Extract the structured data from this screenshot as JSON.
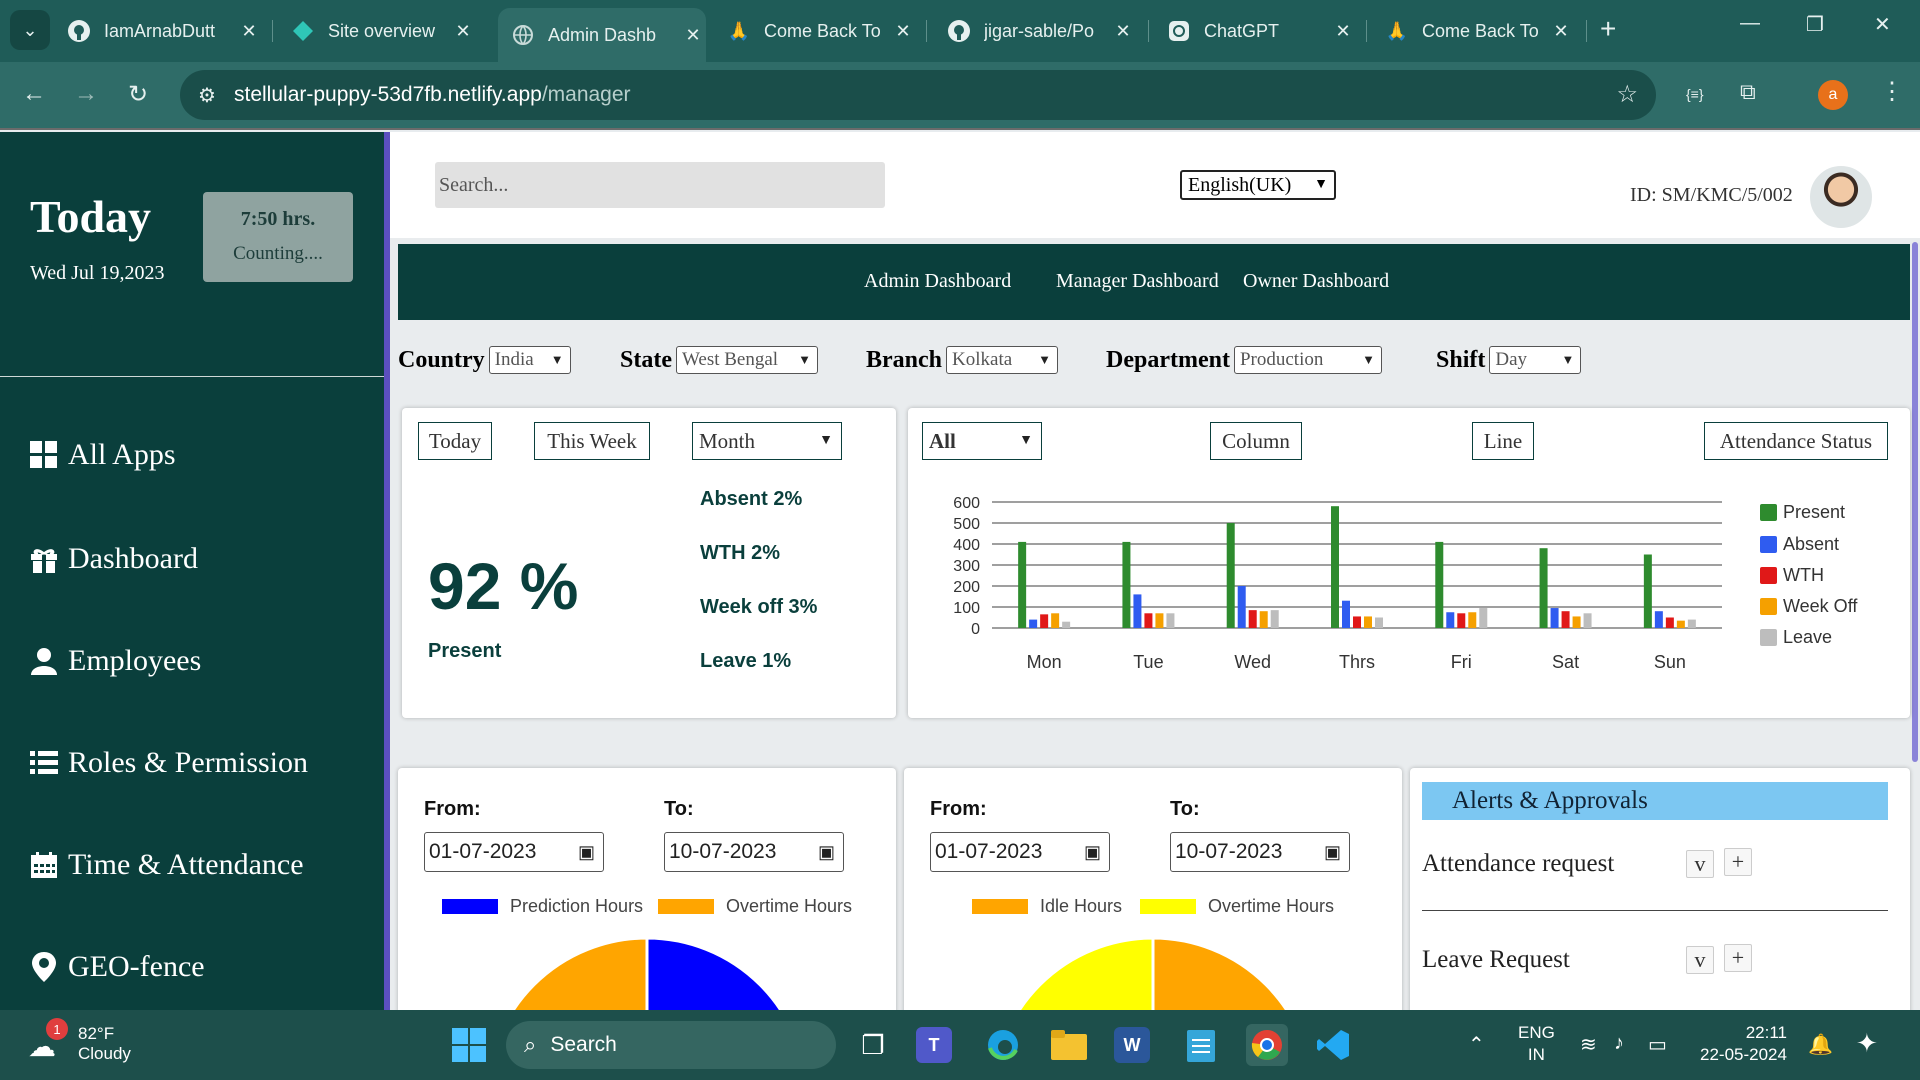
{
  "browser": {
    "tabs": [
      {
        "title": "IamArnabDutt",
        "icon": "github-icon"
      },
      {
        "title": "Site overview",
        "icon": "netlify-icon"
      },
      {
        "title": "Admin Dashb",
        "icon": "globe-icon"
      },
      {
        "title": "Come Back To",
        "icon": "folded-hands-icon"
      },
      {
        "title": "jigar-sable/Po",
        "icon": "github-icon"
      },
      {
        "title": "ChatGPT",
        "icon": "chatgpt-icon"
      },
      {
        "title": "Come Back To",
        "icon": "folded-hands-icon"
      }
    ],
    "url_host": "stellular-puppy-53d7fb.netlify.app",
    "url_path": "/manager",
    "profile_initial": "a"
  },
  "sidebar": {
    "today_title": "Today",
    "today_date": "Wed Jul 19,2023",
    "clock_time": "7:50 hrs.",
    "clock_status": "Counting....",
    "items": [
      {
        "label": "All Apps",
        "icon": "grid-icon"
      },
      {
        "label": "Dashboard",
        "icon": "gift-icon"
      },
      {
        "label": "Employees",
        "icon": "user-icon"
      },
      {
        "label": "Roles & Permission",
        "icon": "list-icon"
      },
      {
        "label": "Time & Attendance",
        "icon": "calendar-icon"
      },
      {
        "label": "GEO-fence",
        "icon": "location-pin-icon"
      }
    ]
  },
  "header": {
    "search_placeholder": "Search...",
    "language": "English(UK)",
    "user_id": "ID: SM/KMC/5/002"
  },
  "dashboards": [
    "Admin Dashboard",
    "Manager Dashboard",
    "Owner Dashboard"
  ],
  "filters": [
    {
      "label": "Country",
      "value": "India"
    },
    {
      "label": "State",
      "value": "West Bengal"
    },
    {
      "label": "Branch",
      "value": "Kolkata"
    },
    {
      "label": "Department",
      "value": "Production"
    },
    {
      "label": "Shift",
      "value": "Day"
    }
  ],
  "summary": {
    "periods": [
      "Today",
      "This Week"
    ],
    "period_select": "Month",
    "present_pct": "92 %",
    "present_label": "Present",
    "stats": [
      "Absent 2%",
      "WTH 2%",
      "Week off 3%",
      "Leave 1%"
    ]
  },
  "chart_controls": {
    "filter": "All",
    "column": "Column",
    "line": "Line",
    "status": "Attendance Status"
  },
  "chart_data": {
    "type": "bar",
    "categories": [
      "Mon",
      "Tue",
      "Wed",
      "Thrs",
      "Fri",
      "Sat",
      "Sun"
    ],
    "ylim": [
      0,
      600
    ],
    "yticks": [
      0,
      100,
      200,
      300,
      400,
      500,
      600
    ],
    "legend_position": "right",
    "series": [
      {
        "name": "Present",
        "color": "#2e8b2e",
        "values": [
          410,
          410,
          500,
          580,
          410,
          380,
          350
        ]
      },
      {
        "name": "Absent",
        "color": "#2f5cf0",
        "values": [
          40,
          160,
          200,
          130,
          75,
          95,
          80
        ]
      },
      {
        "name": "WTH",
        "color": "#e01818",
        "values": [
          65,
          70,
          85,
          55,
          70,
          80,
          50
        ]
      },
      {
        "name": "Week Off",
        "color": "#f5a000",
        "values": [
          70,
          70,
          80,
          55,
          75,
          55,
          35
        ]
      },
      {
        "name": "Leave",
        "color": "#bdbdbd",
        "values": [
          30,
          70,
          85,
          50,
          95,
          70,
          40
        ]
      }
    ]
  },
  "hours_left": {
    "from_label": "From:",
    "to_label": "To:",
    "from_value": "01-07-2023",
    "to_value": "10-07-2023",
    "legend": [
      {
        "name": "Prediction Hours",
        "color": "#0000ff"
      },
      {
        "name": "Overtime Hours",
        "color": "#ffa500"
      }
    ]
  },
  "hours_right": {
    "from_label": "From:",
    "to_label": "To:",
    "from_value": "01-07-2023",
    "to_value": "10-07-2023",
    "legend": [
      {
        "name": "Idle Hours",
        "color": "#ffa500"
      },
      {
        "name": "Overtime Hours",
        "color": "#ffff00"
      }
    ]
  },
  "alerts": {
    "title": "Alerts & Approvals",
    "items": [
      {
        "label": "Attendance request",
        "collapse": "v",
        "add": "+"
      },
      {
        "label": "Leave Request",
        "collapse": "v",
        "add": "+"
      }
    ]
  },
  "taskbar": {
    "temp": "82°F",
    "condition": "Cloudy",
    "badge": "1",
    "search": "Search",
    "lang1": "ENG",
    "lang2": "IN",
    "time": "22:11",
    "date": "22-05-2024"
  }
}
